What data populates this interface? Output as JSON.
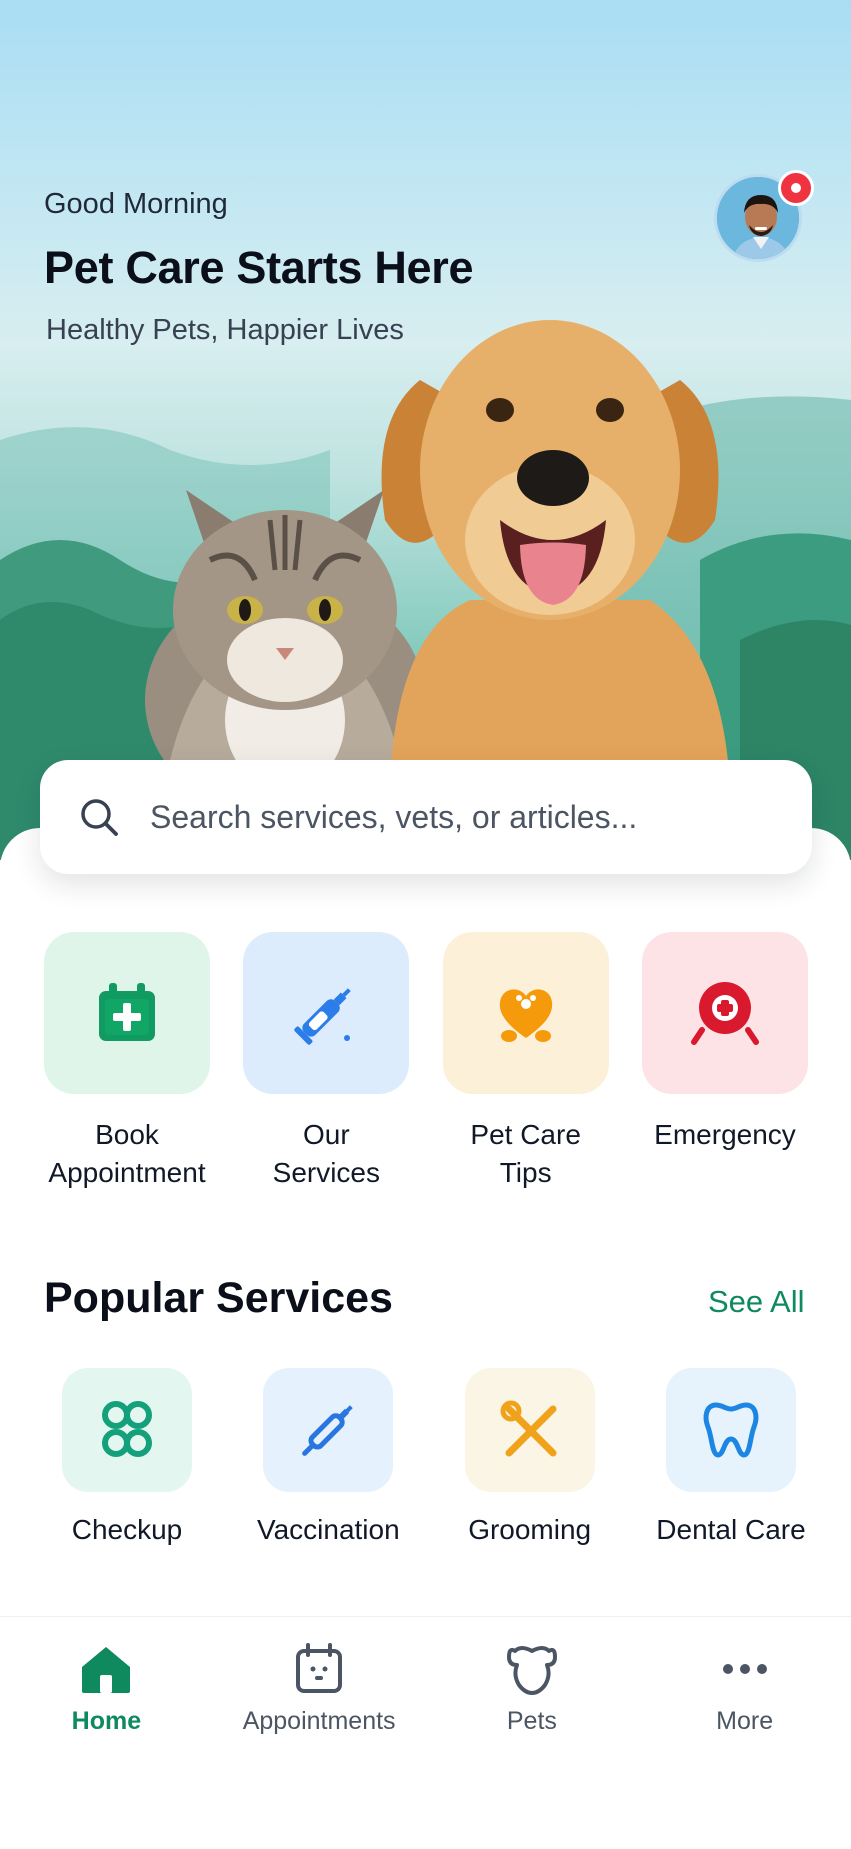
{
  "header": {
    "greeting": "Good Morning",
    "title": "Pet Care Starts Here",
    "subtitle": "Healthy Pets, Happier Lives"
  },
  "search": {
    "placeholder": "Search services, vets, or articles..."
  },
  "quick_actions": [
    {
      "label": "Book\nAppointment",
      "icon": "calendar-plus-icon",
      "tile_color": "#dff5ea",
      "icon_color": "#119a61"
    },
    {
      "label": "Our\nServices",
      "icon": "syringe-icon",
      "tile_color": "#dcecfd",
      "icon_color": "#2b7de9"
    },
    {
      "label": "Pet Care\nTips",
      "icon": "heart-paw-icon",
      "tile_color": "#fdf0d8",
      "icon_color": "#f59a0b"
    },
    {
      "label": "Emergency",
      "icon": "emergency-icon",
      "tile_color": "#fde3e6",
      "icon_color": "#d8192e"
    }
  ],
  "popular": {
    "title": "Popular Services",
    "see_all": "See All",
    "items": [
      {
        "label": "Checkup",
        "icon": "stethoscope-icon",
        "tile_color": "#e3f7f0",
        "icon_color": "#13a07a"
      },
      {
        "label": "Vaccination",
        "icon": "syringe-icon",
        "tile_color": "#e5f2fd",
        "icon_color": "#2a76e0"
      },
      {
        "label": "Grooming",
        "icon": "scissors-icon",
        "tile_color": "#fbf5e6",
        "icon_color": "#f0a21b"
      },
      {
        "label": "Dental Care",
        "icon": "tooth-icon",
        "tile_color": "#e6f3fd",
        "icon_color": "#1d86e3"
      }
    ]
  },
  "nav": {
    "items": [
      {
        "label": "Home",
        "icon": "home-icon",
        "active": true
      },
      {
        "label": "Appointments",
        "icon": "calendar-icon",
        "active": false
      },
      {
        "label": "Pets",
        "icon": "pet-face-icon",
        "active": false
      },
      {
        "label": "More",
        "icon": "more-dots-icon",
        "active": false
      }
    ]
  },
  "colors": {
    "accent": "#0f8a5f",
    "notification": "#ef3340"
  }
}
